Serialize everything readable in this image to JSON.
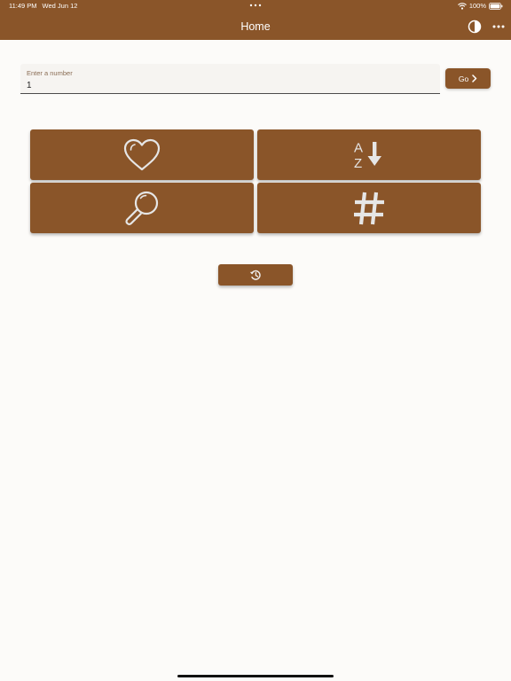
{
  "status_bar": {
    "time": "11:49 PM",
    "date": "Wed Jun 12",
    "battery": "100%"
  },
  "header": {
    "title": "Home",
    "background_color": "#8a5529",
    "icons": {
      "theme": "contrast-icon",
      "more": "more-horizontal-icon"
    }
  },
  "number_input": {
    "label": "Enter a number",
    "value": "1"
  },
  "go_button": {
    "label": "Go",
    "icon": "chevron-right-icon"
  },
  "tiles": [
    {
      "name": "favorites",
      "icon": "heart-icon"
    },
    {
      "name": "alphabetical-sort",
      "icon": "sort-alphabetical-icon",
      "letters": [
        "A",
        "Z"
      ]
    },
    {
      "name": "search",
      "icon": "search-icon"
    },
    {
      "name": "number",
      "icon": "hash-icon"
    }
  ],
  "history_button": {
    "icon": "history-icon"
  },
  "colors": {
    "accent": "#8a5529",
    "background": "#fcfbf9",
    "icon": "#e6e6e6"
  }
}
